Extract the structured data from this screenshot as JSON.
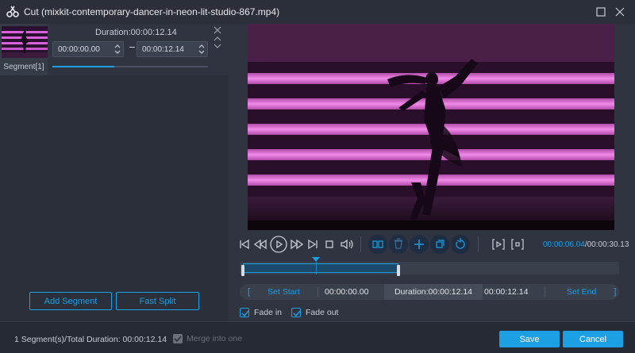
{
  "window": {
    "title": "Cut (mixkit-contemporary-dancer-in-neon-lit-studio-867.mp4)",
    "logo_icon": "scissors-logo-icon",
    "controls": [
      "maximize-icon",
      "close-icon"
    ]
  },
  "segment": {
    "label": "Segment[1]",
    "duration": "Duration:00:00:12.14",
    "start_time": "00:00:00.00",
    "end_time": "00:00:12.14",
    "progress": 0.4
  },
  "left_actions": {
    "add_segment": "Add Segment",
    "fast_split": "Fast Split"
  },
  "player": {
    "current_time": "00:00:06.04",
    "total_time": "/00:00:30.13",
    "playhead_fraction": 0.2
  },
  "set_bar": {
    "set_start": "Set Start",
    "start_time": "00:00:00.00",
    "duration": "Duration:00:00:12.14",
    "end_time": "00:00:12.14",
    "set_end": "Set End",
    "bracket_open": "[",
    "bracket_close": "]"
  },
  "fade": {
    "fade_in": "Fade in",
    "fade_out": "Fade out",
    "fade_in_checked": true,
    "fade_out_checked": true
  },
  "footer": {
    "info": "1 Segment(s)/Total Duration: 00:00:12.14",
    "merge_label": "Merge into one",
    "save": "Save",
    "cancel": "Cancel"
  },
  "colors": {
    "accent": "#1c9fe3",
    "background": "#2b2f3a",
    "neon": "#e86ae0"
  }
}
